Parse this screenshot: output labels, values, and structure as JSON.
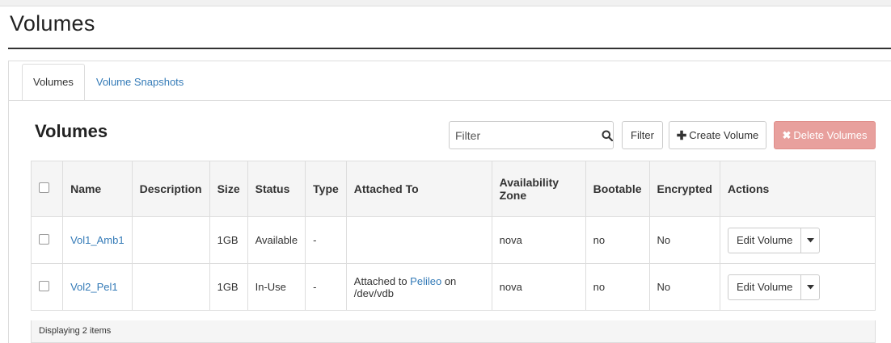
{
  "page": {
    "title": "Volumes"
  },
  "tabs": [
    {
      "label": "Volumes",
      "active": true
    },
    {
      "label": "Volume Snapshots",
      "active": false
    }
  ],
  "section": {
    "title": "Volumes"
  },
  "toolbar": {
    "filter_placeholder": "Filter",
    "filter_button": "Filter",
    "create_button": "Create Volume",
    "delete_button": "Delete Volumes"
  },
  "table": {
    "columns": [
      "Name",
      "Description",
      "Size",
      "Status",
      "Type",
      "Attached To",
      "Availability Zone",
      "Bootable",
      "Encrypted",
      "Actions"
    ],
    "rows": [
      {
        "name": "Vol1_Amb1",
        "description": "",
        "size": "1GB",
        "status": "Available",
        "type": "-",
        "attached_prefix": "",
        "attached_link": "",
        "attached_suffix": "",
        "zone": "nova",
        "bootable": "no",
        "encrypted": "No",
        "action": "Edit Volume"
      },
      {
        "name": "Vol2_Pel1",
        "description": "",
        "size": "1GB",
        "status": "In-Use",
        "type": "-",
        "attached_prefix": "Attached to ",
        "attached_link": "Pelileo",
        "attached_suffix": " on /dev/vdb",
        "zone": "nova",
        "bootable": "no",
        "encrypted": "No",
        "action": "Edit Volume"
      }
    ],
    "footer": "Displaying 2 items"
  },
  "colors": {
    "link": "#337ab7",
    "danger": "#e8a09d"
  },
  "icons": {
    "search": "search-icon",
    "plus": "plus-icon",
    "close": "close-icon",
    "caret": "caret-down-icon"
  }
}
